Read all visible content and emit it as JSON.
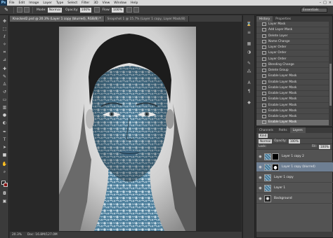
{
  "app": {
    "logo": "Ps",
    "menu": [
      "File",
      "Edit",
      "Image",
      "Layer",
      "Type",
      "Select",
      "Filter",
      "3D",
      "View",
      "Window",
      "Help"
    ],
    "window_buttons": [
      "–",
      "□",
      "×"
    ]
  },
  "options": {
    "mode_label": "Mode:",
    "mode_value": "Normal",
    "opacity_label": "Opacity:",
    "opacity_value": "100%",
    "flow_label": "Flow:",
    "flow_value": "100%",
    "workspace": "Essentials"
  },
  "document": {
    "tabs": [
      {
        "label": "Knocked2.psd @ 20.3% (Layer 1 copy (blurred), RGB/8) *",
        "active": true
      },
      {
        "label": "Snapshot 1 @ 15.7% (Layer 1 copy, Layer Mask/8)",
        "active": false
      }
    ],
    "zoom": "20.3%",
    "doc_size": "Doc: 16.8M/127.0M"
  },
  "history": {
    "tabs": [
      "History",
      "Properties"
    ],
    "items": [
      "Layer Mask",
      "Add Layer Mask",
      "Delete Layer",
      "Name Change",
      "Layer Order",
      "Layer Order",
      "Layer Order",
      "Blending Change",
      "Delete Group",
      "Enable Layer Mask",
      "Enable Layer Mask",
      "Enable Layer Mask",
      "Enable Layer Mask",
      "Enable Layer Mask",
      "Enable Layer Mask",
      "Enable Layer Mask",
      "Enable Layer Mask",
      "Enable Layer Mask"
    ],
    "active_index": 17
  },
  "layers": {
    "tabs": [
      "Channels",
      "Paths",
      "Layers"
    ],
    "kind_value": "Kind",
    "blend_value": "Normal",
    "opacity_label": "Opacity:",
    "opacity_value": "100%",
    "lock_label": "Lock:",
    "fill_label": "Fill:",
    "fill_value": "100%",
    "rows": [
      {
        "name": "Layer 1 copy 2",
        "thumb": "tex",
        "mask": "black",
        "active": false
      },
      {
        "name": "Layer 1 copy (blurred)",
        "thumb": "tex",
        "mask": "shape",
        "active": true
      },
      {
        "name": "Layer 1 copy",
        "thumb": "tex",
        "mask": "",
        "active": false
      },
      {
        "name": "Layer 1",
        "thumb": "tex",
        "mask": "",
        "active": false
      },
      {
        "name": "Background",
        "thumb": "face",
        "mask": "",
        "active": false
      }
    ]
  }
}
